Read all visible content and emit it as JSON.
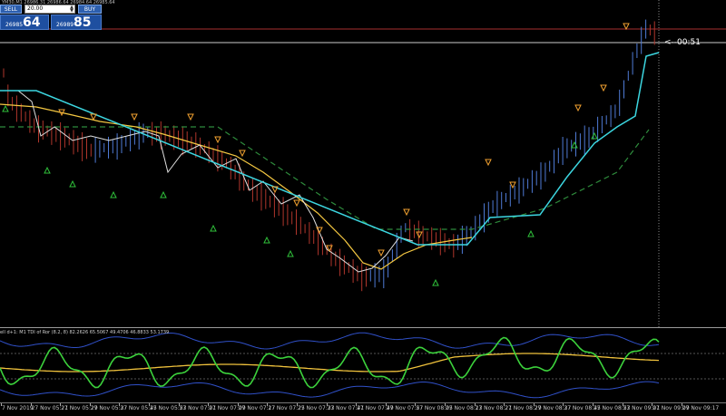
{
  "one_click_panel": {
    "symbol_line": "YM30,M1  26986.31 26986.64 26984.64 26985.64",
    "sell_label": "SELL",
    "buy_label": "BUY",
    "lot_value": "20.00",
    "sell_price_prefix": "26985",
    "sell_price_big": "64",
    "buy_price_prefix": "26989",
    "buy_price_big": "85"
  },
  "timer": {
    "label": "<--00:51"
  },
  "indicator": {
    "title": "ell d+1: M1 TDI of Ror (8.2, 8) 82.2626 65.5067 49.4706 46.8833 53.1739"
  },
  "time_axis": {
    "labels": [
      "7 Nov 2019",
      "27 Nov 05:21",
      "27 Nov 05:29",
      "27 Nov 05:37",
      "27 Nov 05:45",
      "27 Nov 05:53",
      "27 Nov 07:01",
      "27 Nov 07:09",
      "27 Nov 07:17",
      "27 Nov 07:25",
      "27 Nov 07:33",
      "27 Nov 07:41",
      "27 Nov 07:49",
      "27 Nov 07:57",
      "27 Nov 08:05",
      "27 Nov 08:13",
      "27 Nov 08:21",
      "27 Nov 08:29",
      "27 Nov 08:37",
      "27 Nov 08:45",
      "27 Nov 08:53",
      "27 Nov 09:01",
      "27 Nov 09:09",
      "27 Nov 09:17"
    ]
  },
  "colors": {
    "bull_bar": "#4f7bd6",
    "bear_bar": "#b0362c",
    "fast_ma": "#f5c842",
    "slow_dashed": "#2e8b3c",
    "trail_line": "#3cd6e0",
    "up_arrow": "#2fbf3a",
    "down_arrow": "#f0a030",
    "tdi_green": "#3cd23c",
    "tdi_yellow": "#f0c23c",
    "tdi_band": "#3050c8",
    "price_line": "#cccccc",
    "resistance_line": "#a83030"
  }
}
